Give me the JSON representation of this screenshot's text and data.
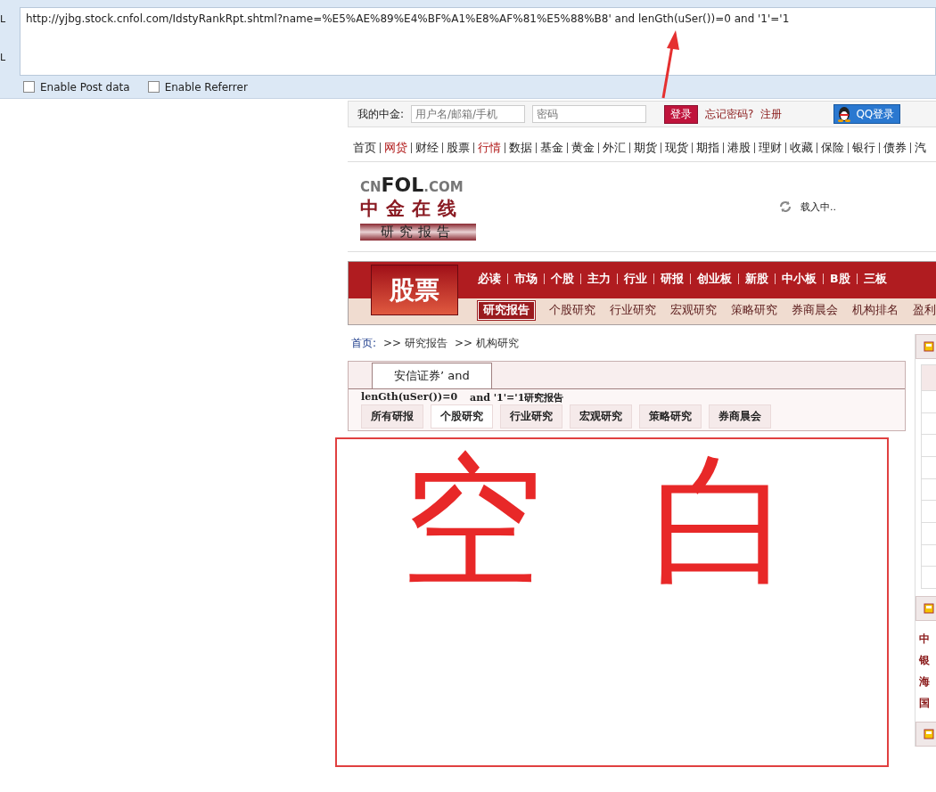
{
  "hackbar": {
    "side_labels": [
      "L",
      "L"
    ],
    "url": "http://yjbg.stock.cnfol.com/IdstyRankRpt.shtml?name=%E5%AE%89%E4%BF%A1%E8%AF%81%E5%88%B8' and  lenGth(uSer())=0 and '1'='1",
    "options": [
      {
        "label": "Enable Post data",
        "checked": false
      },
      {
        "label": "Enable Referrer",
        "checked": false
      }
    ]
  },
  "login_bar": {
    "label": "我的中金:",
    "username_placeholder": "用户名/邮箱/手机",
    "password_placeholder": "密码",
    "login_button": "登录",
    "forgot_link": "忘记密码?",
    "register_link": "注册",
    "qq_button": "QQ登录"
  },
  "top_nav": [
    {
      "label": "首页",
      "hot": false
    },
    {
      "label": "网贷",
      "hot": true
    },
    {
      "label": "财经",
      "hot": false
    },
    {
      "label": "股票",
      "hot": false
    },
    {
      "label": "行情",
      "hot": true
    },
    {
      "label": "数据",
      "hot": false
    },
    {
      "label": "基金",
      "hot": false
    },
    {
      "label": "黄金",
      "hot": false
    },
    {
      "label": "外汇",
      "hot": false
    },
    {
      "label": "期货",
      "hot": false
    },
    {
      "label": "现货",
      "hot": false
    },
    {
      "label": "期指",
      "hot": false
    },
    {
      "label": "港股",
      "hot": false
    },
    {
      "label": "理财",
      "hot": false
    },
    {
      "label": "收藏",
      "hot": false
    },
    {
      "label": "保险",
      "hot": false
    },
    {
      "label": "银行",
      "hot": false
    },
    {
      "label": "债券",
      "hot": false
    },
    {
      "label": "汽",
      "hot": false
    }
  ],
  "logo": {
    "brand_prefix": "CN",
    "brand_main": "FOL",
    "brand_suffix": ".COM",
    "name": "中金在线",
    "section": "研究报告"
  },
  "loading": "载入中..",
  "section_banner": {
    "title": "股票",
    "primary_nav": [
      "必读",
      "市场",
      "个股",
      "主力",
      "行业",
      "研报",
      "创业板",
      "新股",
      "中小板",
      "B股",
      "三板"
    ],
    "secondary_nav": [
      {
        "label": "研究报告",
        "selected": true
      },
      {
        "label": "个股研究",
        "selected": false
      },
      {
        "label": "行业研究",
        "selected": false
      },
      {
        "label": "宏观研究",
        "selected": false
      },
      {
        "label": "策略研究",
        "selected": false
      },
      {
        "label": "券商晨会",
        "selected": false
      },
      {
        "label": "机构排名",
        "selected": false
      },
      {
        "label": "盈利",
        "selected": false
      }
    ]
  },
  "breadcrumb": [
    "首页:",
    ">> 研究报告",
    ">> 机构研究"
  ],
  "report_panel": {
    "title_tab": "安信证券’ and",
    "title_overflow": [
      "lenGth(uSer())=0",
      "and '1'='1研究报告"
    ],
    "tabs": [
      {
        "label": "所有研报",
        "selected": false
      },
      {
        "label": "个股研究",
        "selected": true
      },
      {
        "label": "行业研究",
        "selected": false
      },
      {
        "label": "宏观研究",
        "selected": false
      },
      {
        "label": "策略研究",
        "selected": false
      },
      {
        "label": "券商晨会",
        "selected": false
      }
    ]
  },
  "right_panel": {
    "items": [
      "中",
      "银",
      "海",
      "国"
    ]
  },
  "annotation": {
    "note": "空白"
  }
}
